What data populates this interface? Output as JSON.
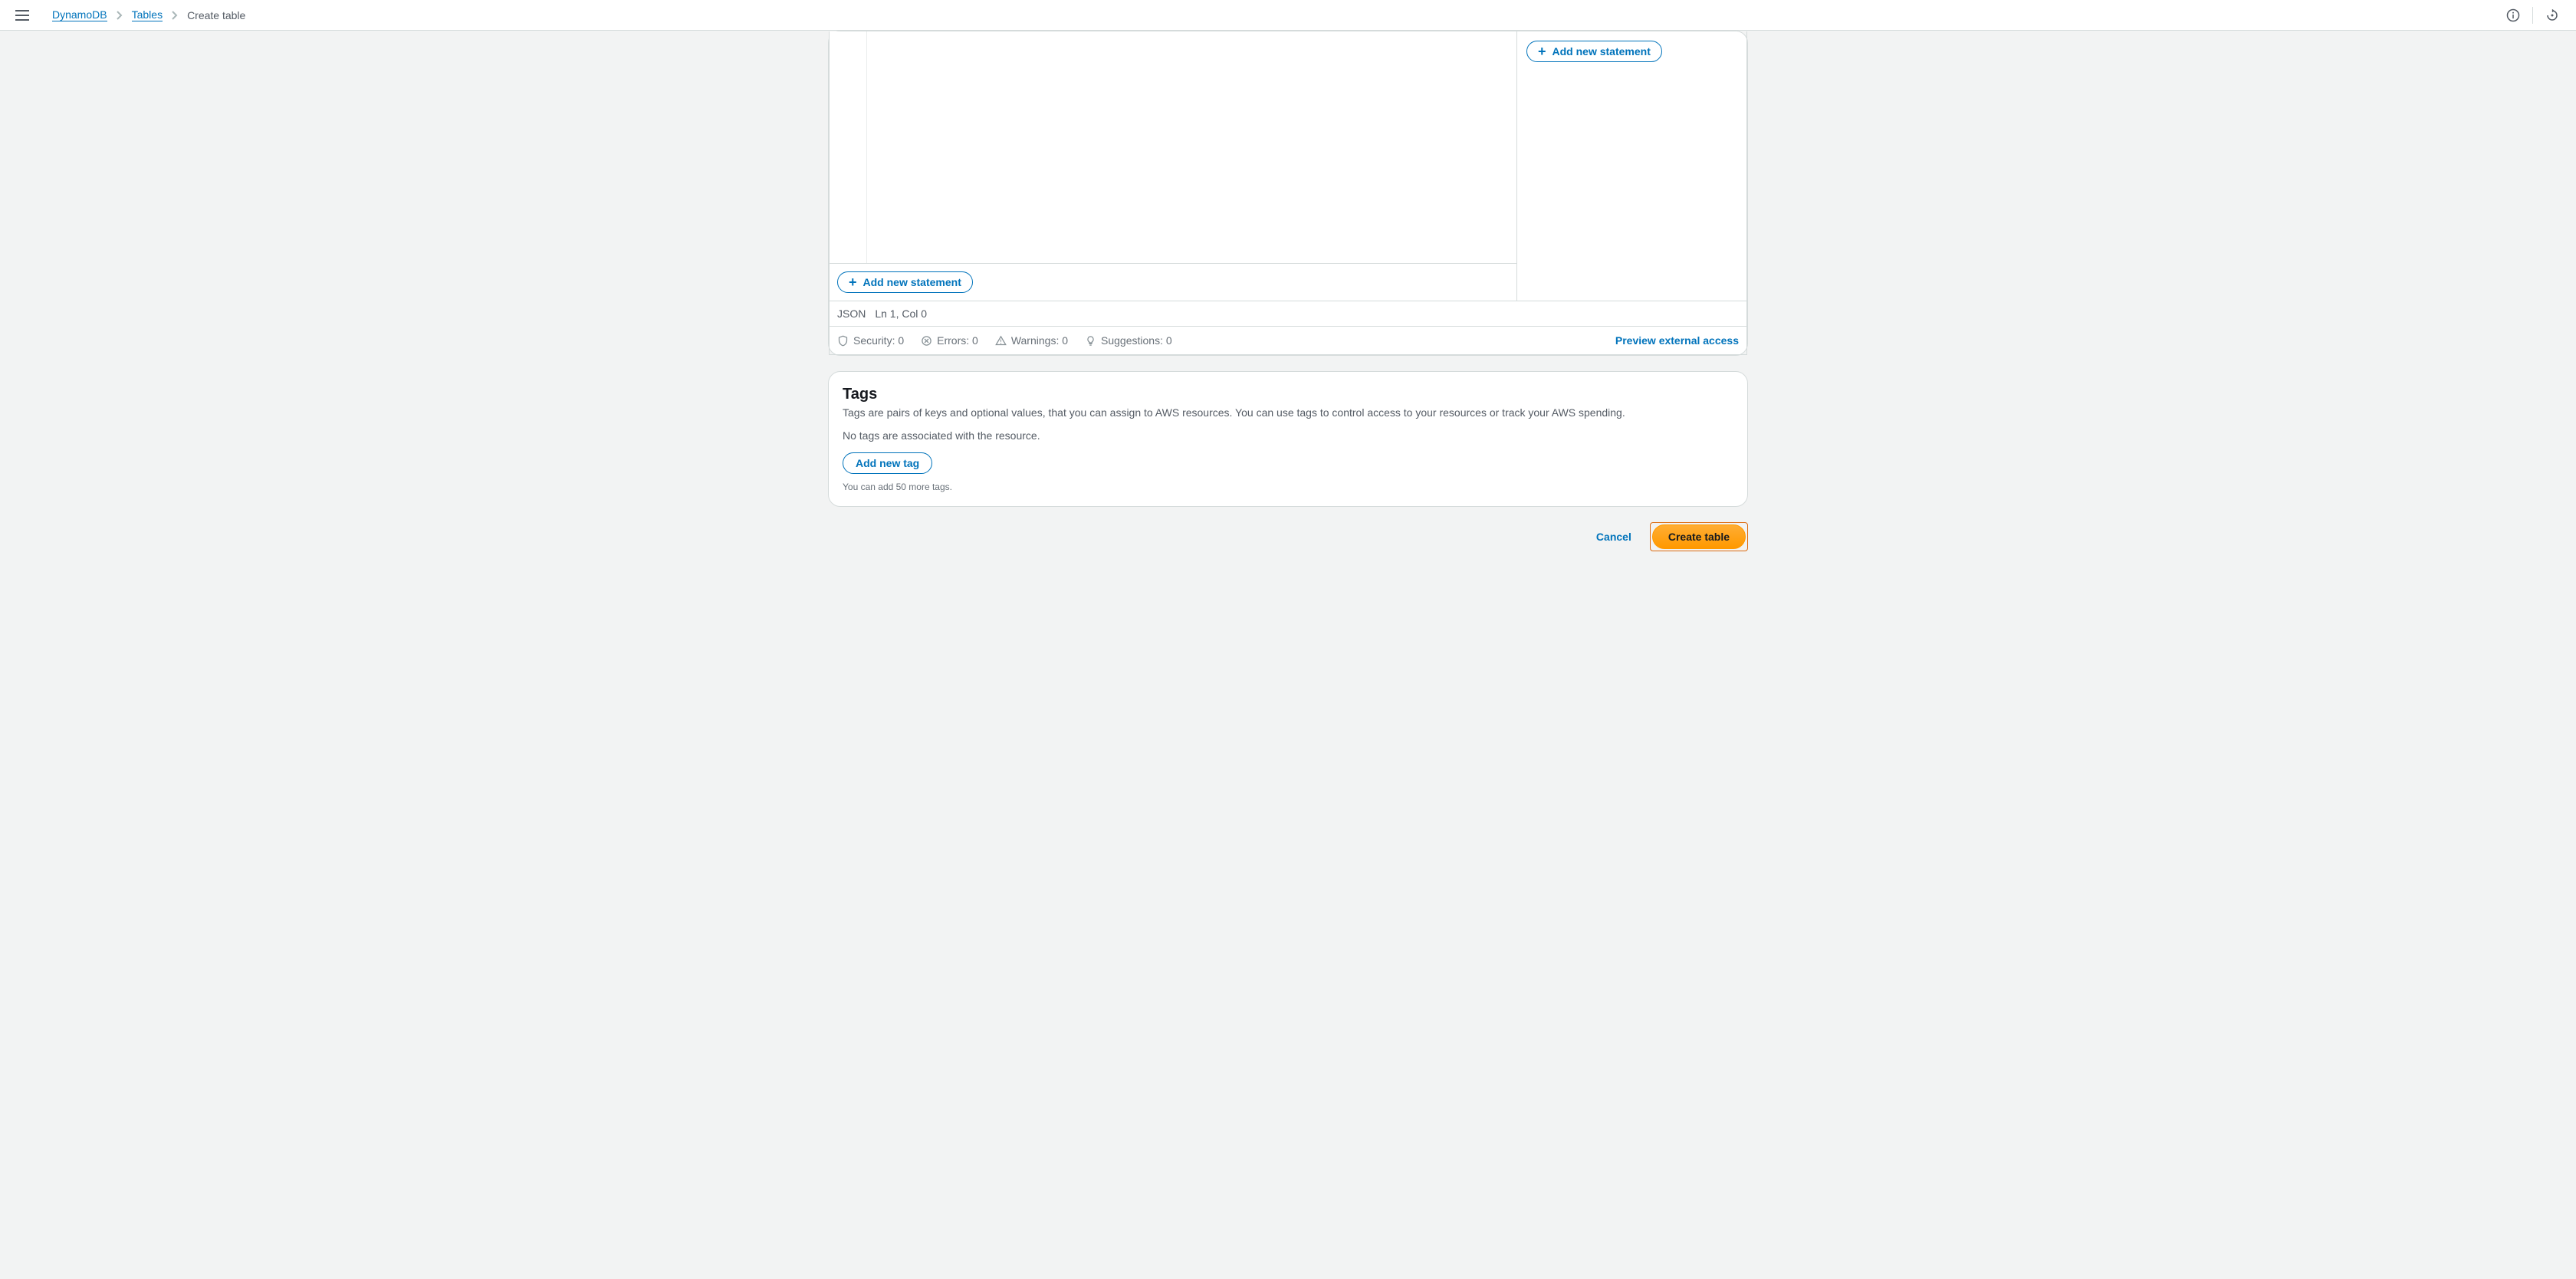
{
  "breadcrumb": {
    "items": [
      "DynamoDB",
      "Tables",
      "Create table"
    ]
  },
  "editor": {
    "left_add_statement": "Add new statement",
    "right_add_statement": "Add new statement",
    "json_label": "JSON",
    "position_label": "Ln 1, Col 0",
    "security_label": "Security: 0",
    "errors_label": "Errors: 0",
    "warnings_label": "Warnings: 0",
    "suggestions_label": "Suggestions: 0",
    "preview_label": "Preview external access"
  },
  "tags": {
    "title": "Tags",
    "description": "Tags are pairs of keys and optional values, that you can assign to AWS resources. You can use tags to control access to your resources or track your AWS spending.",
    "empty_text": "No tags are associated with the resource.",
    "add_button": "Add new tag",
    "hint": "You can add 50 more tags."
  },
  "actions": {
    "cancel": "Cancel",
    "create": "Create table"
  }
}
